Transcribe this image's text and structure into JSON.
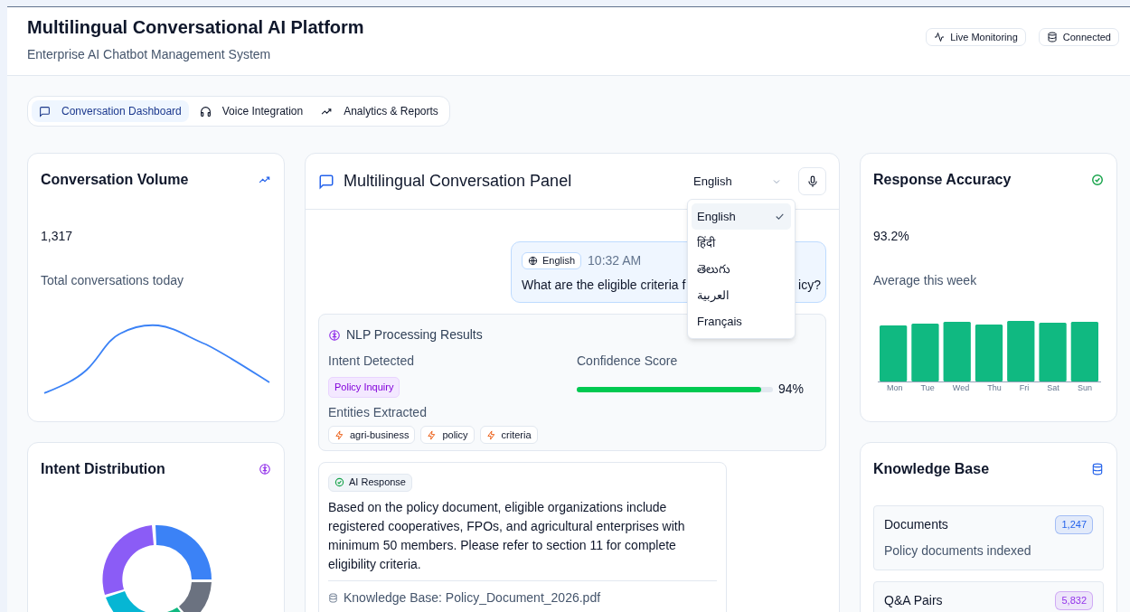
{
  "header": {
    "title": "Multilingual Conversational AI Platform",
    "subtitle": "Enterprise AI Chatbot Management System",
    "badges": [
      {
        "kind": "activity",
        "label": "Live Monitoring"
      },
      {
        "kind": "database",
        "label": "Connected"
      }
    ]
  },
  "tabs": [
    {
      "kind": "chat",
      "label": "Conversation Dashboard",
      "selected": true
    },
    {
      "kind": "headphones",
      "label": "Voice Integration",
      "selected": false
    },
    {
      "kind": "trend",
      "label": "Analytics & Reports",
      "selected": false
    }
  ],
  "conversation_volume": {
    "title": "Conversation Volume",
    "value": "1,317",
    "caption": "Total conversations today"
  },
  "intent_distribution": {
    "title": "Intent Distribution"
  },
  "conversation_panel": {
    "title": "Multilingual Conversation Panel",
    "language_select": {
      "value": "English",
      "expanded": true,
      "options": [
        {
          "label": "English",
          "selected": true
        },
        {
          "label": "हिंदी",
          "selected": false
        },
        {
          "label": "తెలుగు",
          "selected": false
        },
        {
          "label": "العربية",
          "selected": false
        },
        {
          "label": "Français",
          "selected": false
        }
      ]
    },
    "user_message": {
      "language": "English",
      "time": "10:32 AM",
      "text_start": "What are the eligible criteria f",
      "text_end": "icy?"
    },
    "nlp": {
      "title": "NLP Processing Results",
      "intent_label": "Intent Detected",
      "intent": "Policy Inquiry",
      "confidence_label": "Confidence Score",
      "confidence": {
        "level": 0.94,
        "reading": "94%"
      },
      "entities_label": "Entities Extracted",
      "entities": [
        "agri-business",
        "policy",
        "criteria"
      ]
    },
    "ai_response": {
      "badge": "AI Response",
      "text": "Based on the policy document, eligible organizations include registered cooperatives, FPOs, and agricultural enterprises with minimum 50 members. Please refer to section 11 for complete eligibility criteria.",
      "source": "Knowledge Base: Policy_Document_2026.pdf"
    }
  },
  "response_accuracy": {
    "title": "Response Accuracy",
    "value": "93.2%",
    "caption": "Average this week",
    "day_labels": [
      "Mon",
      "Tue",
      "Wed",
      "Thu",
      "Fri",
      "Sat",
      "Sun"
    ]
  },
  "knowledge_base": {
    "title": "Knowledge Base",
    "items": [
      {
        "name": "Documents",
        "count": "1,247",
        "color": "#2563eb",
        "description": "Policy documents indexed"
      },
      {
        "name": "Q&A Pairs",
        "count": "5,832",
        "color": "#9333ea"
      }
    ]
  }
}
